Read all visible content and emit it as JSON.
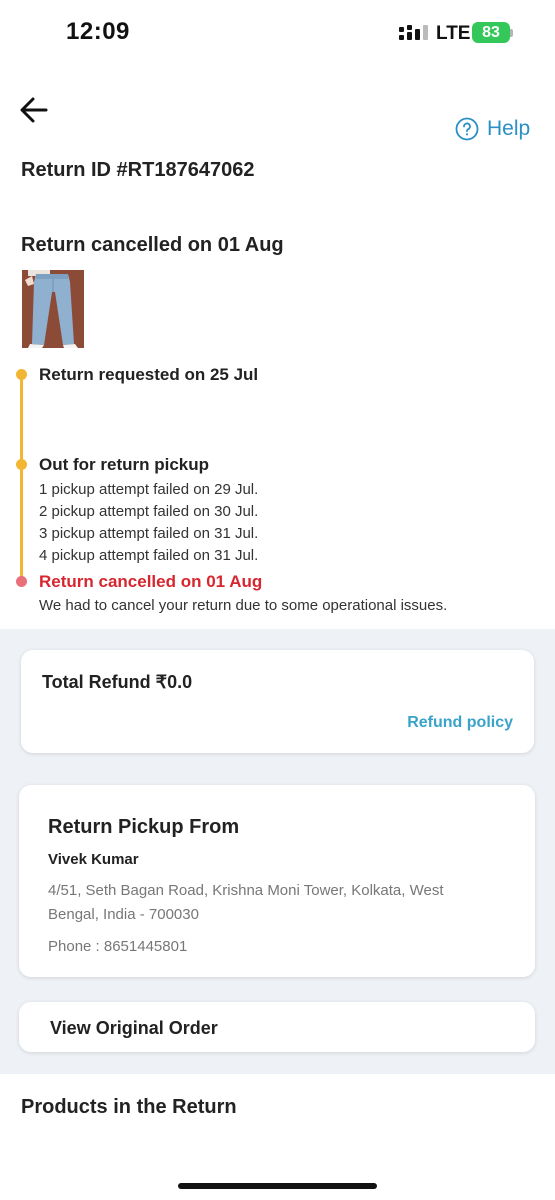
{
  "status_bar": {
    "time": "12:09",
    "network": "LTE",
    "battery": "83",
    "battery_color": "#34c759"
  },
  "header": {
    "back_icon": "arrow-left-icon",
    "help_icon": "question-circle-icon",
    "help_label": "Help",
    "accent_color": "#2b8fc5"
  },
  "return_info": {
    "id_label": "Return ID #RT187647062",
    "status_heading": "Return cancelled on 01 Aug"
  },
  "timeline": {
    "steps": [
      {
        "title": "Return requested on 25 Jul",
        "details": []
      },
      {
        "title": "Out for return pickup",
        "details": [
          "1 pickup attempt failed on 29 Jul.",
          "2 pickup attempt failed on 30 Jul.",
          "3 pickup attempt failed on 31 Jul.",
          "4 pickup attempt failed on 31 Jul."
        ]
      },
      {
        "title": "Return cancelled on 01 Aug",
        "details": [
          "We had to cancel your return due to some operational issues."
        ]
      }
    ],
    "line_color": "#f2b632",
    "cancel_color": "#d7262f"
  },
  "refund": {
    "total_label": "Total Refund ₹0.0",
    "policy_link": "Refund policy"
  },
  "pickup": {
    "title": "Return Pickup From",
    "name": "Vivek Kumar",
    "address": "4/51, Seth Bagan Road, Krishna Moni Tower, Kolkata, West Bengal, India - 700030",
    "phone": "Phone : 8651445801"
  },
  "order": {
    "view_original_label": "View Original Order"
  },
  "products": {
    "heading": "Products in the Return"
  }
}
